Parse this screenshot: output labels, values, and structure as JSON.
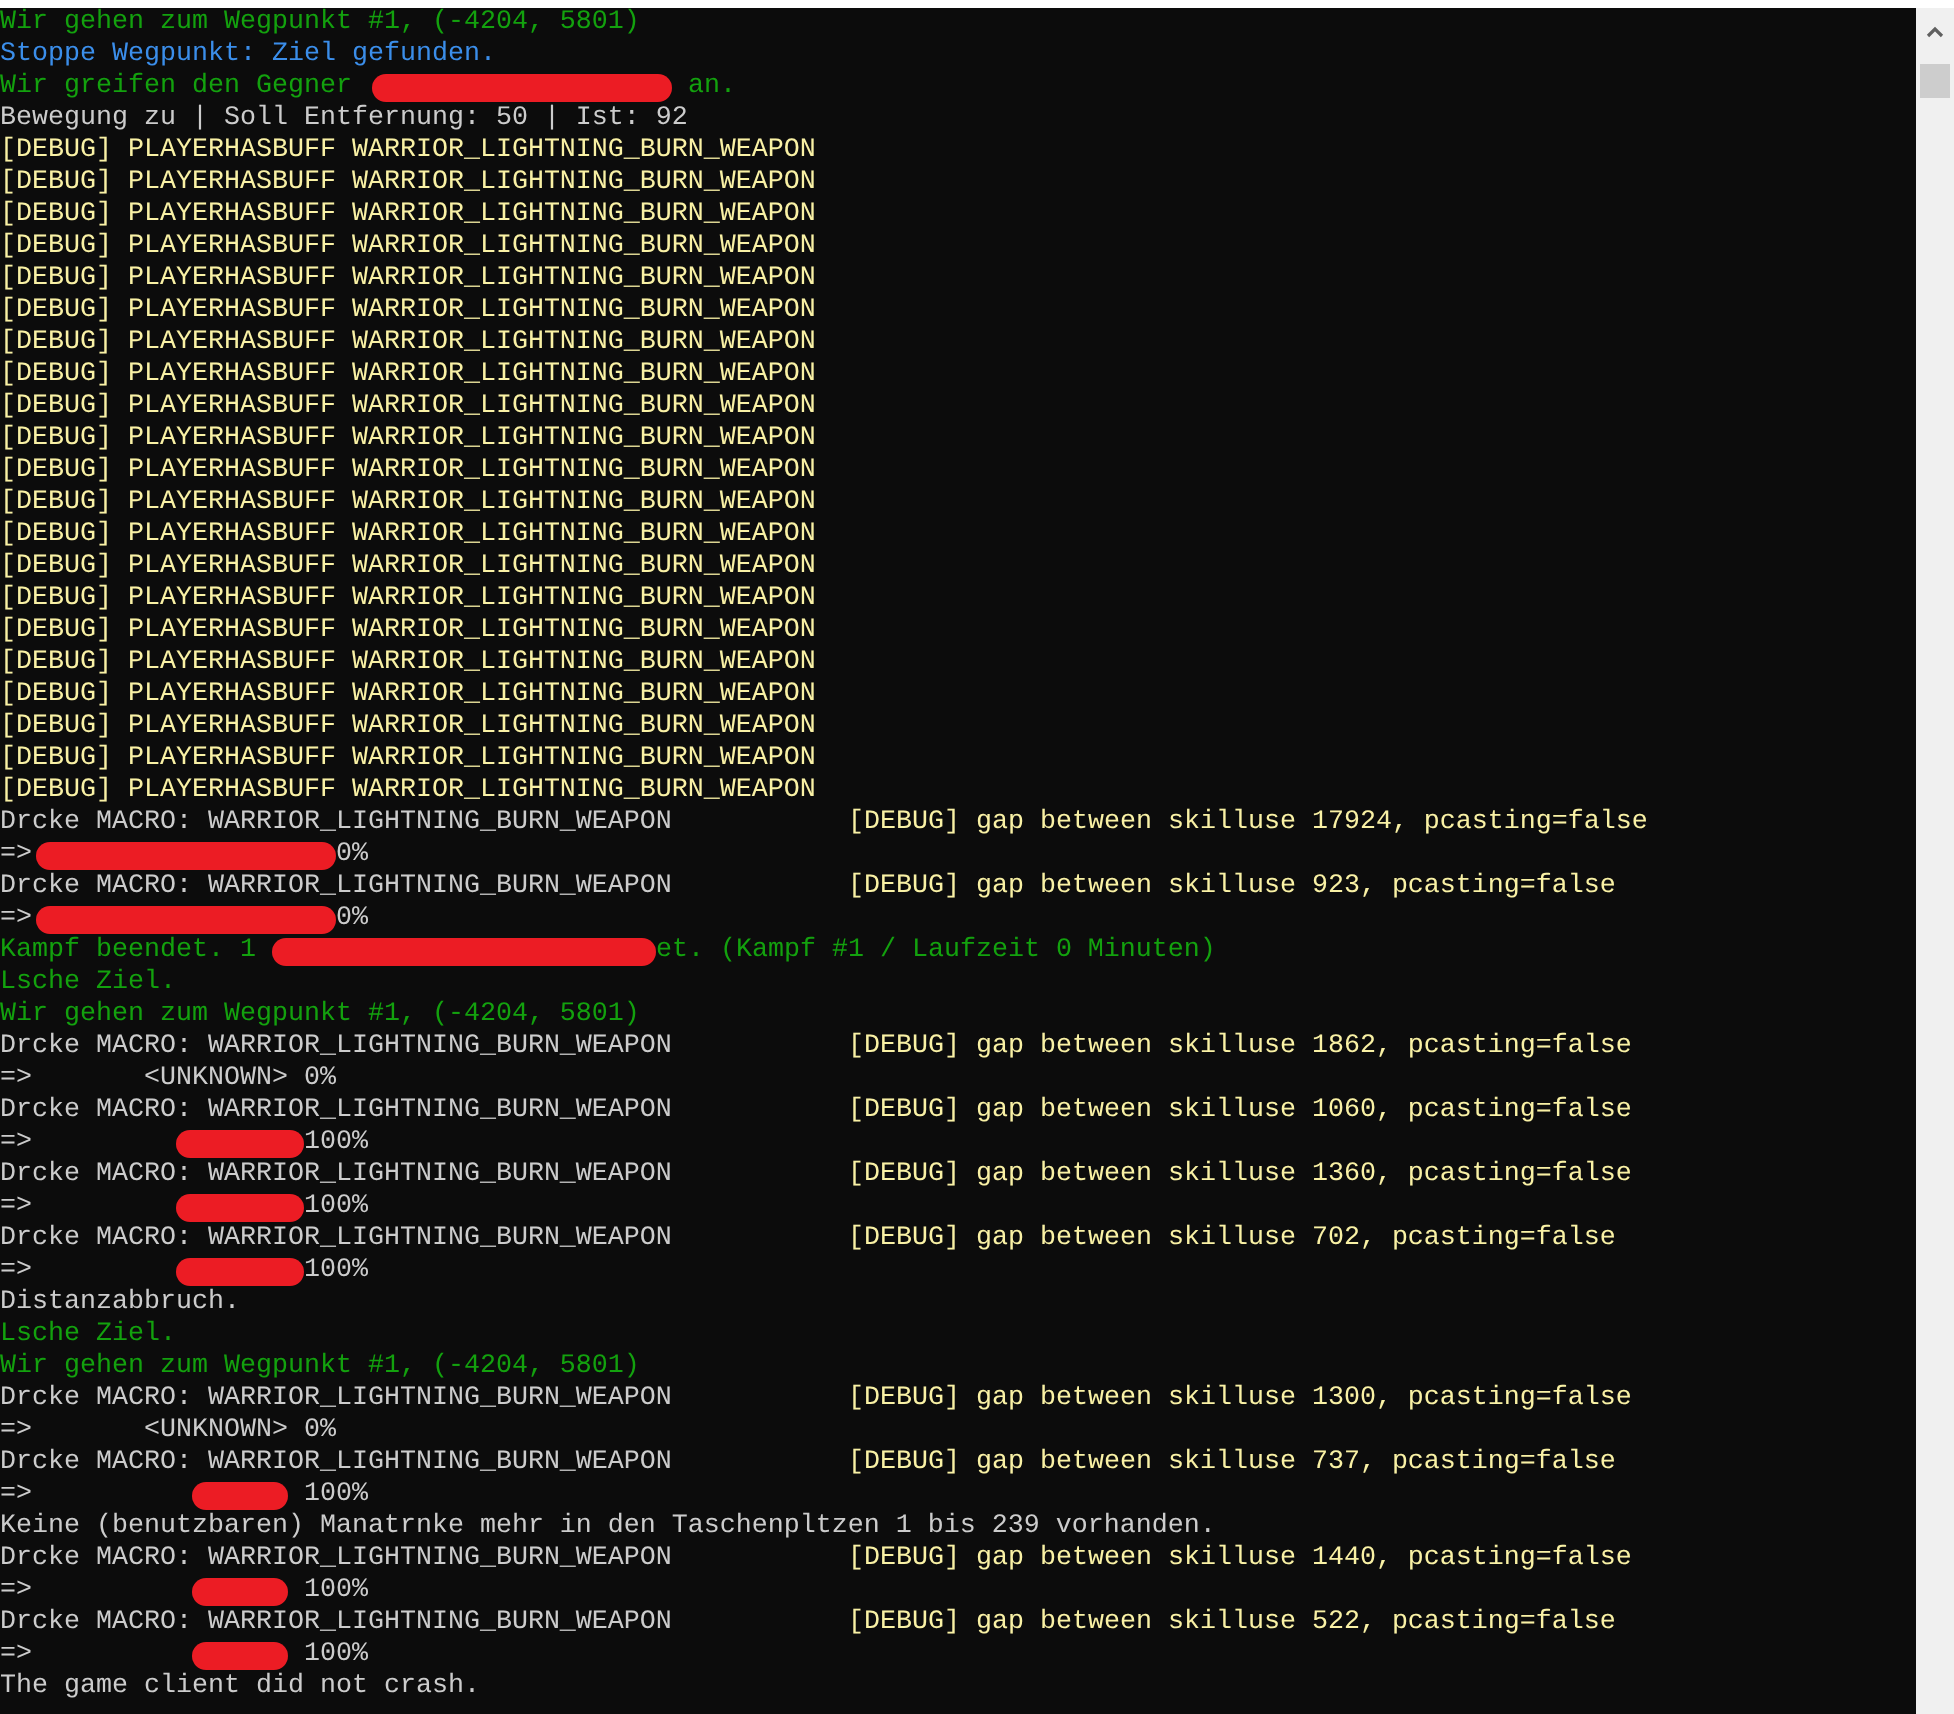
{
  "console": {
    "lines": [
      {
        "kind": "status",
        "segments": [
          {
            "kind": "text",
            "text": "Wir gehen zum Wegpunkt #1, (-4204, 5801)"
          }
        ]
      },
      {
        "kind": "info",
        "segments": [
          {
            "kind": "text",
            "text": "Stoppe Wegpunkt: Ziel gefunden."
          }
        ]
      },
      {
        "kind": "status",
        "segments": [
          {
            "kind": "text",
            "text": "Wir greifen den Gegner "
          },
          {
            "kind": "longmark"
          },
          {
            "kind": "text",
            "text": " an."
          }
        ]
      },
      {
        "kind": "plain",
        "segments": [
          {
            "kind": "text",
            "text": "Bewegung zu | Soll Entfernung: 50 | Ist: 92"
          }
        ]
      },
      {
        "kind": "debug",
        "segments": [
          {
            "kind": "text",
            "text": "[DEBUG] PLAYERHASBUFF WARRIOR_LIGHTNING_BURN_WEAPON"
          }
        ]
      },
      {
        "kind": "debug",
        "segments": [
          {
            "kind": "text",
            "text": "[DEBUG] PLAYERHASBUFF WARRIOR_LIGHTNING_BURN_WEAPON"
          }
        ]
      },
      {
        "kind": "debug",
        "segments": [
          {
            "kind": "text",
            "text": "[DEBUG] PLAYERHASBUFF WARRIOR_LIGHTNING_BURN_WEAPON"
          }
        ]
      },
      {
        "kind": "debug",
        "segments": [
          {
            "kind": "text",
            "text": "[DEBUG] PLAYERHASBUFF WARRIOR_LIGHTNING_BURN_WEAPON"
          }
        ]
      },
      {
        "kind": "debug",
        "segments": [
          {
            "kind": "text",
            "text": "[DEBUG] PLAYERHASBUFF WARRIOR_LIGHTNING_BURN_WEAPON"
          }
        ]
      },
      {
        "kind": "debug",
        "segments": [
          {
            "kind": "text",
            "text": "[DEBUG] PLAYERHASBUFF WARRIOR_LIGHTNING_BURN_WEAPON"
          }
        ]
      },
      {
        "kind": "debug",
        "segments": [
          {
            "kind": "text",
            "text": "[DEBUG] PLAYERHASBUFF WARRIOR_LIGHTNING_BURN_WEAPON"
          }
        ]
      },
      {
        "kind": "debug",
        "segments": [
          {
            "kind": "text",
            "text": "[DEBUG] PLAYERHASBUFF WARRIOR_LIGHTNING_BURN_WEAPON"
          }
        ]
      },
      {
        "kind": "debug",
        "segments": [
          {
            "kind": "text",
            "text": "[DEBUG] PLAYERHASBUFF WARRIOR_LIGHTNING_BURN_WEAPON"
          }
        ]
      },
      {
        "kind": "debug",
        "segments": [
          {
            "kind": "text",
            "text": "[DEBUG] PLAYERHASBUFF WARRIOR_LIGHTNING_BURN_WEAPON"
          }
        ]
      },
      {
        "kind": "debug",
        "segments": [
          {
            "kind": "text",
            "text": "[DEBUG] PLAYERHASBUFF WARRIOR_LIGHTNING_BURN_WEAPON"
          }
        ]
      },
      {
        "kind": "debug",
        "segments": [
          {
            "kind": "text",
            "text": "[DEBUG] PLAYERHASBUFF WARRIOR_LIGHTNING_BURN_WEAPON"
          }
        ]
      },
      {
        "kind": "debug",
        "segments": [
          {
            "kind": "text",
            "text": "[DEBUG] PLAYERHASBUFF WARRIOR_LIGHTNING_BURN_WEAPON"
          }
        ]
      },
      {
        "kind": "debug",
        "segments": [
          {
            "kind": "text",
            "text": "[DEBUG] PLAYERHASBUFF WARRIOR_LIGHTNING_BURN_WEAPON"
          }
        ]
      },
      {
        "kind": "debug",
        "segments": [
          {
            "kind": "text",
            "text": "[DEBUG] PLAYERHASBUFF WARRIOR_LIGHTNING_BURN_WEAPON"
          }
        ]
      },
      {
        "kind": "debug",
        "segments": [
          {
            "kind": "text",
            "text": "[DEBUG] PLAYERHASBUFF WARRIOR_LIGHTNING_BURN_WEAPON"
          }
        ]
      },
      {
        "kind": "debug",
        "segments": [
          {
            "kind": "text",
            "text": "[DEBUG] PLAYERHASBUFF WARRIOR_LIGHTNING_BURN_WEAPON"
          }
        ]
      },
      {
        "kind": "debug",
        "segments": [
          {
            "kind": "text",
            "text": "[DEBUG] PLAYERHASBUFF WARRIOR_LIGHTNING_BURN_WEAPON"
          }
        ]
      },
      {
        "kind": "debug",
        "segments": [
          {
            "kind": "text",
            "text": "[DEBUG] PLAYERHASBUFF WARRIOR_LIGHTNING_BURN_WEAPON"
          }
        ]
      },
      {
        "kind": "debug",
        "segments": [
          {
            "kind": "text",
            "text": "[DEBUG] PLAYERHASBUFF WARRIOR_LIGHTNING_BURN_WEAPON"
          }
        ]
      },
      {
        "kind": "debug",
        "segments": [
          {
            "kind": "text",
            "text": "[DEBUG] PLAYERHASBUFF WARRIOR_LIGHTNING_BURN_WEAPON"
          }
        ]
      },
      {
        "kind": "plain",
        "segments": [
          {
            "kind": "text",
            "text": "Drcke MACRO: WARRIOR_LIGHTNING_BURN_WEAPON"
          }
        ],
        "debug": "[DEBUG] gap between skilluse 17924, pcasting=false"
      },
      {
        "kind": "plain",
        "segments": [
          {
            "kind": "text",
            "text": "=>"
          },
          {
            "kind": "longmark"
          },
          {
            "kind": "text",
            "text": "0%"
          }
        ]
      },
      {
        "kind": "plain",
        "segments": [
          {
            "kind": "text",
            "text": "Drcke MACRO: WARRIOR_LIGHTNING_BURN_WEAPON"
          }
        ],
        "debug": "[DEBUG] gap between skilluse 923, pcasting=false"
      },
      {
        "kind": "plain",
        "segments": [
          {
            "kind": "text",
            "text": "=>"
          },
          {
            "kind": "longmark"
          },
          {
            "kind": "text",
            "text": "0%"
          }
        ]
      },
      {
        "kind": "status",
        "segments": [
          {
            "kind": "text",
            "text": "Kampf beendet. 1 "
          },
          {
            "kind": "widemark"
          },
          {
            "kind": "text",
            "text": "et. (Kampf #1 / Laufzeit 0 Minuten)"
          }
        ]
      },
      {
        "kind": "status",
        "segments": [
          {
            "kind": "text",
            "text": "Lsche Ziel."
          }
        ]
      },
      {
        "kind": "status",
        "segments": [
          {
            "kind": "text",
            "text": "Wir gehen zum Wegpunkt #1, (-4204, 5801)"
          }
        ]
      },
      {
        "kind": "plain",
        "segments": [
          {
            "kind": "text",
            "text": "Drcke MACRO: WARRIOR_LIGHTNING_BURN_WEAPON"
          }
        ],
        "debug": "[DEBUG] gap between skilluse 1862, pcasting=false"
      },
      {
        "kind": "plain",
        "segments": [
          {
            "kind": "text",
            "text": "=>       <UNKNOWN> 0%"
          }
        ]
      },
      {
        "kind": "plain",
        "segments": [
          {
            "kind": "text",
            "text": "Drcke MACRO: WARRIOR_LIGHTNING_BURN_WEAPON"
          }
        ],
        "debug": "[DEBUG] gap between skilluse 1060, pcasting=false"
      },
      {
        "kind": "plain",
        "segments": [
          {
            "kind": "text",
            "text": "=>"
          },
          {
            "kind": "shortmark"
          },
          {
            "kind": "text",
            "text": "100%"
          }
        ]
      },
      {
        "kind": "plain",
        "segments": [
          {
            "kind": "text",
            "text": "Drcke MACRO: WARRIOR_LIGHTNING_BURN_WEAPON"
          }
        ],
        "debug": "[DEBUG] gap between skilluse 1360, pcasting=false"
      },
      {
        "kind": "plain",
        "segments": [
          {
            "kind": "text",
            "text": "=>"
          },
          {
            "kind": "shortmark"
          },
          {
            "kind": "text",
            "text": "100%"
          }
        ]
      },
      {
        "kind": "plain",
        "segments": [
          {
            "kind": "text",
            "text": "Drcke MACRO: WARRIOR_LIGHTNING_BURN_WEAPON"
          }
        ],
        "debug": "[DEBUG] gap between skilluse 702, pcasting=false"
      },
      {
        "kind": "plain",
        "segments": [
          {
            "kind": "text",
            "text": "=>"
          },
          {
            "kind": "shortmark"
          },
          {
            "kind": "text",
            "text": "100%"
          }
        ]
      },
      {
        "kind": "plain",
        "segments": [
          {
            "kind": "text",
            "text": "Distanzabbruch."
          }
        ]
      },
      {
        "kind": "status",
        "segments": [
          {
            "kind": "text",
            "text": "Lsche Ziel."
          }
        ]
      },
      {
        "kind": "status",
        "segments": [
          {
            "kind": "text",
            "text": "Wir gehen zum Wegpunkt #1, (-4204, 5801)"
          }
        ]
      },
      {
        "kind": "plain",
        "segments": [
          {
            "kind": "text",
            "text": "Drcke MACRO: WARRIOR_LIGHTNING_BURN_WEAPON"
          }
        ],
        "debug": "[DEBUG] gap between skilluse 1300, pcasting=false"
      },
      {
        "kind": "plain",
        "segments": [
          {
            "kind": "text",
            "text": "=>       <UNKNOWN> 0%"
          }
        ]
      },
      {
        "kind": "plain",
        "segments": [
          {
            "kind": "text",
            "text": "Drcke MACRO: WARRIOR_LIGHTNING_BURN_WEAPON"
          }
        ],
        "debug": "[DEBUG] gap between skilluse 737, pcasting=false"
      },
      {
        "kind": "plain",
        "segments": [
          {
            "kind": "text",
            "text": "=>"
          },
          {
            "kind": "tinymark"
          },
          {
            "kind": "text",
            "text": "100%"
          }
        ]
      },
      {
        "kind": "plain",
        "segments": [
          {
            "kind": "text",
            "text": "Keine (benutzbaren) Manatrnke mehr in den Taschenpltzen 1 bis 239 vorhanden."
          }
        ]
      },
      {
        "kind": "plain",
        "segments": [
          {
            "kind": "text",
            "text": "Drcke MACRO: WARRIOR_LIGHTNING_BURN_WEAPON"
          }
        ],
        "debug": "[DEBUG] gap between skilluse 1440, pcasting=false"
      },
      {
        "kind": "plain",
        "segments": [
          {
            "kind": "text",
            "text": "=>"
          },
          {
            "kind": "tinymark"
          },
          {
            "kind": "text",
            "text": "100%"
          }
        ]
      },
      {
        "kind": "plain",
        "segments": [
          {
            "kind": "text",
            "text": "Drcke MACRO: WARRIOR_LIGHTNING_BURN_WEAPON"
          }
        ],
        "debug": "[DEBUG] gap between skilluse 522, pcasting=false"
      },
      {
        "kind": "plain",
        "segments": [
          {
            "kind": "text",
            "text": "=>"
          },
          {
            "kind": "tinymark"
          },
          {
            "kind": "text",
            "text": "100%"
          }
        ]
      },
      {
        "kind": "plain",
        "segments": [
          {
            "kind": "text",
            "text": "The game client did not crash."
          }
        ]
      }
    ]
  }
}
